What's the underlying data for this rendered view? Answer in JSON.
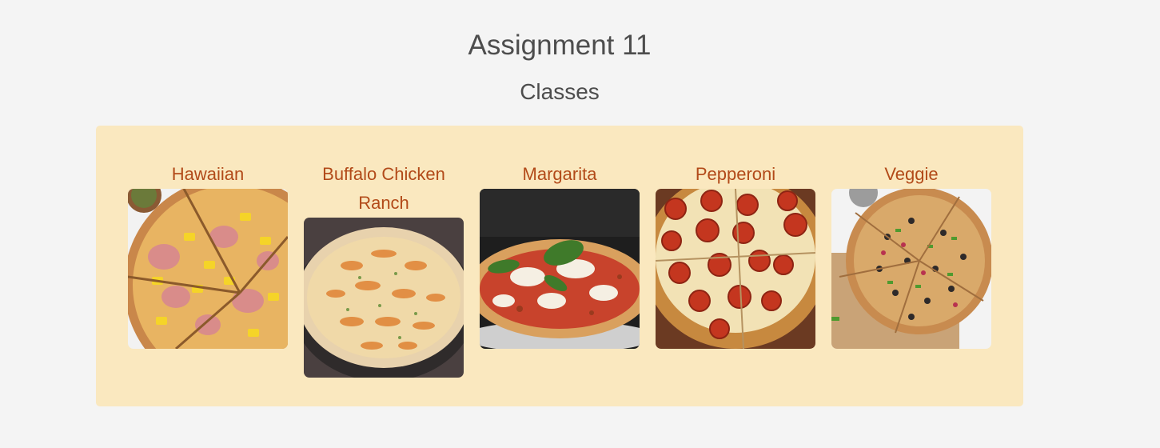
{
  "page": {
    "title": "Assignment 11",
    "subtitle": "Classes"
  },
  "pizzas": [
    {
      "name": "Hawaiian"
    },
    {
      "name": "Buffalo Chicken Ranch"
    },
    {
      "name": "Margarita"
    },
    {
      "name": "Pepperoni"
    },
    {
      "name": "Veggie"
    }
  ],
  "colors": {
    "background": "#f4f4f4",
    "panel": "#fae8bf",
    "card_title": "#b24a19",
    "heading": "#4d4d4d"
  }
}
